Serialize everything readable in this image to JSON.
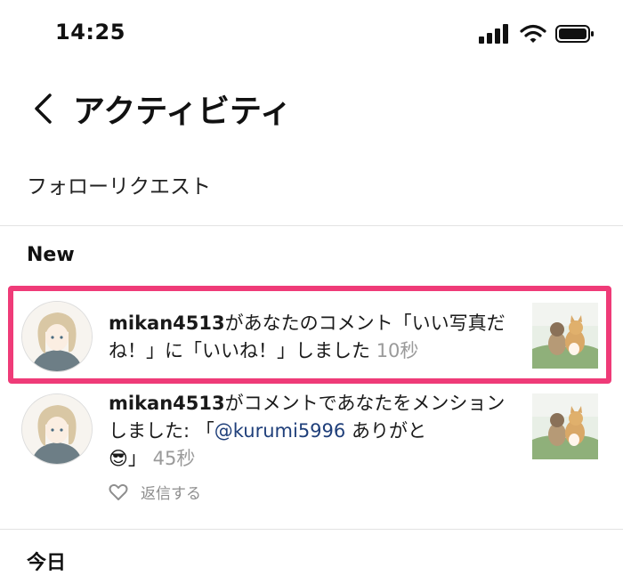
{
  "status_bar": {
    "time": "14:25"
  },
  "header": {
    "title": "アクティビティ"
  },
  "follow_requests": {
    "label": "フォローリクエスト"
  },
  "sections": {
    "new": "New",
    "today": "今日"
  },
  "notifications": [
    {
      "username": "mikan4513",
      "message": "があなたのコメント「いい写真だね！」に「いいね！」しました",
      "time": "10秒",
      "highlighted": true
    },
    {
      "username": "mikan4513",
      "message_before": "がコメントであなたをメンションしました: 「",
      "mention": "@kurumi5996",
      "message_after": " ありがと",
      "emoji": "😎",
      "closing": "」",
      "time": "45秒",
      "reply_label": "返信する"
    }
  ],
  "colors": {
    "highlight": "#ef3b78",
    "mention": "#1f3f7a",
    "timestamp": "#9a9a9a"
  },
  "icons": [
    "signal-icon",
    "wifi-icon",
    "battery-icon",
    "back-chevron-icon",
    "heart-icon"
  ]
}
